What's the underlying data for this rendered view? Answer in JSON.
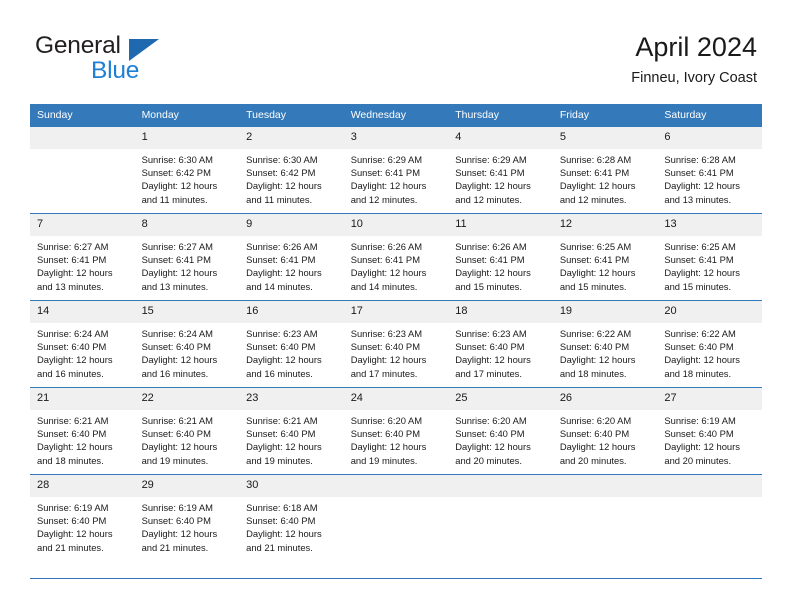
{
  "brand": {
    "name_part1": "General",
    "name_part2": "Blue",
    "accent_color": "#1f7fd4",
    "triangle_color": "#1e69b0"
  },
  "header": {
    "title": "April 2024",
    "subtitle": "Finneu, Ivory Coast"
  },
  "calendar": {
    "header_bg": "#3479ba",
    "daynum_bg": "#f0f0f0",
    "weekdays": [
      "Sunday",
      "Monday",
      "Tuesday",
      "Wednesday",
      "Thursday",
      "Friday",
      "Saturday"
    ],
    "weeks": [
      [
        {
          "day": "",
          "empty": true
        },
        {
          "day": "1",
          "sunrise": "Sunrise: 6:30 AM",
          "sunset": "Sunset: 6:42 PM",
          "daylight_line1": "Daylight: 12 hours",
          "daylight_line2": "and 11 minutes."
        },
        {
          "day": "2",
          "sunrise": "Sunrise: 6:30 AM",
          "sunset": "Sunset: 6:42 PM",
          "daylight_line1": "Daylight: 12 hours",
          "daylight_line2": "and 11 minutes."
        },
        {
          "day": "3",
          "sunrise": "Sunrise: 6:29 AM",
          "sunset": "Sunset: 6:41 PM",
          "daylight_line1": "Daylight: 12 hours",
          "daylight_line2": "and 12 minutes."
        },
        {
          "day": "4",
          "sunrise": "Sunrise: 6:29 AM",
          "sunset": "Sunset: 6:41 PM",
          "daylight_line1": "Daylight: 12 hours",
          "daylight_line2": "and 12 minutes."
        },
        {
          "day": "5",
          "sunrise": "Sunrise: 6:28 AM",
          "sunset": "Sunset: 6:41 PM",
          "daylight_line1": "Daylight: 12 hours",
          "daylight_line2": "and 12 minutes."
        },
        {
          "day": "6",
          "sunrise": "Sunrise: 6:28 AM",
          "sunset": "Sunset: 6:41 PM",
          "daylight_line1": "Daylight: 12 hours",
          "daylight_line2": "and 13 minutes."
        }
      ],
      [
        {
          "day": "7",
          "sunrise": "Sunrise: 6:27 AM",
          "sunset": "Sunset: 6:41 PM",
          "daylight_line1": "Daylight: 12 hours",
          "daylight_line2": "and 13 minutes."
        },
        {
          "day": "8",
          "sunrise": "Sunrise: 6:27 AM",
          "sunset": "Sunset: 6:41 PM",
          "daylight_line1": "Daylight: 12 hours",
          "daylight_line2": "and 13 minutes."
        },
        {
          "day": "9",
          "sunrise": "Sunrise: 6:26 AM",
          "sunset": "Sunset: 6:41 PM",
          "daylight_line1": "Daylight: 12 hours",
          "daylight_line2": "and 14 minutes."
        },
        {
          "day": "10",
          "sunrise": "Sunrise: 6:26 AM",
          "sunset": "Sunset: 6:41 PM",
          "daylight_line1": "Daylight: 12 hours",
          "daylight_line2": "and 14 minutes."
        },
        {
          "day": "11",
          "sunrise": "Sunrise: 6:26 AM",
          "sunset": "Sunset: 6:41 PM",
          "daylight_line1": "Daylight: 12 hours",
          "daylight_line2": "and 15 minutes."
        },
        {
          "day": "12",
          "sunrise": "Sunrise: 6:25 AM",
          "sunset": "Sunset: 6:41 PM",
          "daylight_line1": "Daylight: 12 hours",
          "daylight_line2": "and 15 minutes."
        },
        {
          "day": "13",
          "sunrise": "Sunrise: 6:25 AM",
          "sunset": "Sunset: 6:41 PM",
          "daylight_line1": "Daylight: 12 hours",
          "daylight_line2": "and 15 minutes."
        }
      ],
      [
        {
          "day": "14",
          "sunrise": "Sunrise: 6:24 AM",
          "sunset": "Sunset: 6:40 PM",
          "daylight_line1": "Daylight: 12 hours",
          "daylight_line2": "and 16 minutes."
        },
        {
          "day": "15",
          "sunrise": "Sunrise: 6:24 AM",
          "sunset": "Sunset: 6:40 PM",
          "daylight_line1": "Daylight: 12 hours",
          "daylight_line2": "and 16 minutes."
        },
        {
          "day": "16",
          "sunrise": "Sunrise: 6:23 AM",
          "sunset": "Sunset: 6:40 PM",
          "daylight_line1": "Daylight: 12 hours",
          "daylight_line2": "and 16 minutes."
        },
        {
          "day": "17",
          "sunrise": "Sunrise: 6:23 AM",
          "sunset": "Sunset: 6:40 PM",
          "daylight_line1": "Daylight: 12 hours",
          "daylight_line2": "and 17 minutes."
        },
        {
          "day": "18",
          "sunrise": "Sunrise: 6:23 AM",
          "sunset": "Sunset: 6:40 PM",
          "daylight_line1": "Daylight: 12 hours",
          "daylight_line2": "and 17 minutes."
        },
        {
          "day": "19",
          "sunrise": "Sunrise: 6:22 AM",
          "sunset": "Sunset: 6:40 PM",
          "daylight_line1": "Daylight: 12 hours",
          "daylight_line2": "and 18 minutes."
        },
        {
          "day": "20",
          "sunrise": "Sunrise: 6:22 AM",
          "sunset": "Sunset: 6:40 PM",
          "daylight_line1": "Daylight: 12 hours",
          "daylight_line2": "and 18 minutes."
        }
      ],
      [
        {
          "day": "21",
          "sunrise": "Sunrise: 6:21 AM",
          "sunset": "Sunset: 6:40 PM",
          "daylight_line1": "Daylight: 12 hours",
          "daylight_line2": "and 18 minutes."
        },
        {
          "day": "22",
          "sunrise": "Sunrise: 6:21 AM",
          "sunset": "Sunset: 6:40 PM",
          "daylight_line1": "Daylight: 12 hours",
          "daylight_line2": "and 19 minutes."
        },
        {
          "day": "23",
          "sunrise": "Sunrise: 6:21 AM",
          "sunset": "Sunset: 6:40 PM",
          "daylight_line1": "Daylight: 12 hours",
          "daylight_line2": "and 19 minutes."
        },
        {
          "day": "24",
          "sunrise": "Sunrise: 6:20 AM",
          "sunset": "Sunset: 6:40 PM",
          "daylight_line1": "Daylight: 12 hours",
          "daylight_line2": "and 19 minutes."
        },
        {
          "day": "25",
          "sunrise": "Sunrise: 6:20 AM",
          "sunset": "Sunset: 6:40 PM",
          "daylight_line1": "Daylight: 12 hours",
          "daylight_line2": "and 20 minutes."
        },
        {
          "day": "26",
          "sunrise": "Sunrise: 6:20 AM",
          "sunset": "Sunset: 6:40 PM",
          "daylight_line1": "Daylight: 12 hours",
          "daylight_line2": "and 20 minutes."
        },
        {
          "day": "27",
          "sunrise": "Sunrise: 6:19 AM",
          "sunset": "Sunset: 6:40 PM",
          "daylight_line1": "Daylight: 12 hours",
          "daylight_line2": "and 20 minutes."
        }
      ],
      [
        {
          "day": "28",
          "sunrise": "Sunrise: 6:19 AM",
          "sunset": "Sunset: 6:40 PM",
          "daylight_line1": "Daylight: 12 hours",
          "daylight_line2": "and 21 minutes."
        },
        {
          "day": "29",
          "sunrise": "Sunrise: 6:19 AM",
          "sunset": "Sunset: 6:40 PM",
          "daylight_line1": "Daylight: 12 hours",
          "daylight_line2": "and 21 minutes."
        },
        {
          "day": "30",
          "sunrise": "Sunrise: 6:18 AM",
          "sunset": "Sunset: 6:40 PM",
          "daylight_line1": "Daylight: 12 hours",
          "daylight_line2": "and 21 minutes."
        },
        {
          "day": "",
          "empty": true
        },
        {
          "day": "",
          "empty": true
        },
        {
          "day": "",
          "empty": true
        },
        {
          "day": "",
          "empty": true
        }
      ]
    ]
  }
}
